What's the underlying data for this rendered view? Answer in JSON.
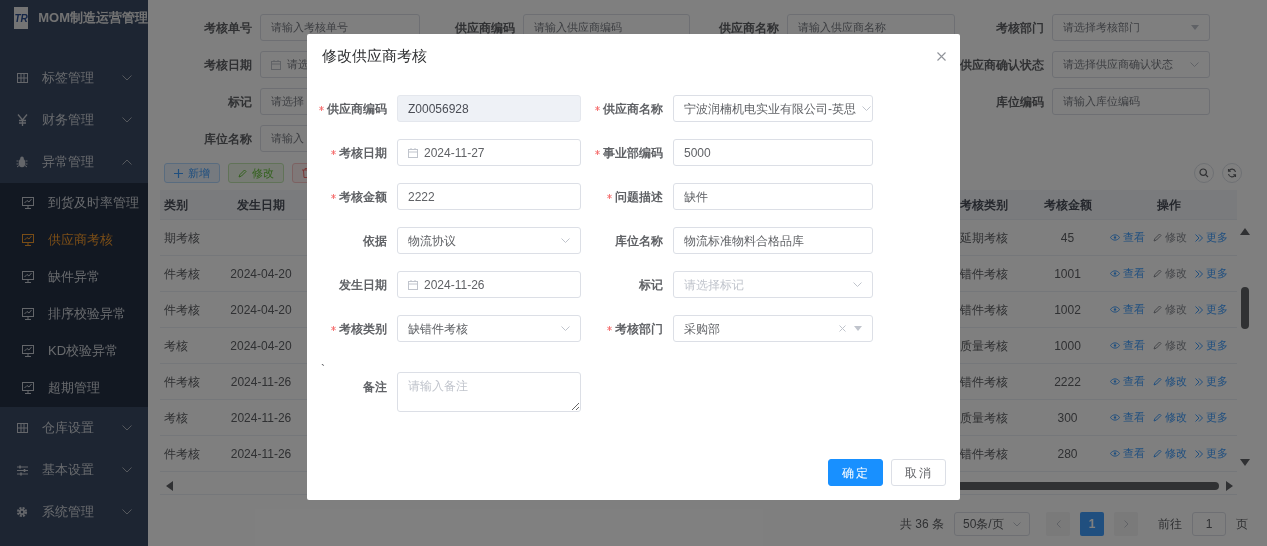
{
  "sidebar": {
    "logo_text": "TR",
    "title": "MOM制造运营管理",
    "items": [
      {
        "label": "标签管理",
        "expanded": false
      },
      {
        "label": "财务管理",
        "expanded": false
      },
      {
        "label": "异常管理",
        "expanded": true,
        "children": [
          {
            "label": "到货及时率管理",
            "selected": false
          },
          {
            "label": "供应商考核",
            "selected": true
          },
          {
            "label": "缺件异常",
            "selected": false
          },
          {
            "label": "排序校验异常",
            "selected": false
          },
          {
            "label": "KD校验异常",
            "selected": false
          },
          {
            "label": "超期管理",
            "selected": false
          }
        ]
      },
      {
        "label": "仓库设置",
        "expanded": false
      },
      {
        "label": "基本设置",
        "expanded": false
      },
      {
        "label": "系统管理",
        "expanded": false
      }
    ]
  },
  "filter_rows": [
    {
      "cells": [
        {
          "label": "考核单号",
          "kind": "text",
          "placeholder": "请输入考核单号"
        },
        {
          "label": "供应商编码",
          "kind": "text",
          "placeholder": "请输入供应商编码"
        },
        {
          "label": "供应商名称",
          "kind": "text",
          "placeholder": "请输入供应商名称"
        },
        {
          "label": "考核部门",
          "kind": "select",
          "placeholder": "请选择考核部门"
        }
      ]
    },
    {
      "cells": [
        {
          "label": "考核日期",
          "kind": "date",
          "placeholder": "请选"
        },
        {
          "label": "供应商确认状态",
          "kind": "chevron",
          "placeholder": "请选择供应商确认状态"
        }
      ]
    },
    {
      "cells": [
        {
          "label": "标记",
          "kind": "text",
          "placeholder": "请选择"
        },
        {
          "label": "库位编码",
          "kind": "text",
          "placeholder": "请输入库位编码"
        }
      ]
    },
    {
      "cells": [
        {
          "label": "库位名称",
          "kind": "text",
          "placeholder": "请输入"
        }
      ]
    }
  ],
  "toolbar": [
    {
      "kind": "add",
      "label": "新增"
    },
    {
      "kind": "edit",
      "label": "修改"
    },
    {
      "kind": "delete"
    }
  ],
  "table": {
    "left_columns": [
      "类别",
      "发生日期"
    ],
    "right_columns": [
      "考核类别",
      "考核金额",
      "操作"
    ],
    "rows": [
      {
        "category_cut": "期考核",
        "category": "延期考核",
        "amount": "45",
        "actions": [
          {
            "kind": "view",
            "label": "查看",
            "disabled": false
          },
          {
            "kind": "edit",
            "label": "修改",
            "disabled": true
          },
          {
            "kind": "more",
            "label": "更多",
            "disabled": false
          }
        ]
      },
      {
        "category_cut": "件考核",
        "date": "2024-04-20",
        "category": "错件考核",
        "amount": "1001",
        "actions": [
          {
            "kind": "view",
            "label": "查看",
            "disabled": false
          },
          {
            "kind": "edit",
            "label": "修改",
            "disabled": true
          },
          {
            "kind": "more",
            "label": "更多",
            "disabled": false
          }
        ]
      },
      {
        "category_cut": "件考核",
        "date": "2024-04-20",
        "category": "错件考核",
        "amount": "1002",
        "actions": [
          {
            "kind": "view",
            "label": "查看",
            "disabled": false
          },
          {
            "kind": "edit",
            "label": "修改",
            "disabled": true
          },
          {
            "kind": "more",
            "label": "更多",
            "disabled": false
          }
        ]
      },
      {
        "category_cut": "考核",
        "date": "2024-04-20",
        "category": "质量考核",
        "amount": "1000",
        "actions": [
          {
            "kind": "view",
            "label": "查看",
            "disabled": false
          },
          {
            "kind": "edit",
            "label": "修改",
            "disabled": true
          },
          {
            "kind": "more",
            "label": "更多",
            "disabled": false
          }
        ]
      },
      {
        "category_cut": "件考核",
        "date": "2024-11-26",
        "category": "错件考核",
        "amount": "2222",
        "actions": [
          {
            "kind": "view",
            "label": "查看",
            "disabled": false
          },
          {
            "kind": "edit",
            "label": "修改",
            "disabled": false
          },
          {
            "kind": "more",
            "label": "更多",
            "disabled": false
          }
        ]
      },
      {
        "category_cut": "考核",
        "date": "2024-11-26",
        "category": "质量考核",
        "amount": "300",
        "actions": [
          {
            "kind": "view",
            "label": "查看",
            "disabled": false
          },
          {
            "kind": "edit",
            "label": "修改",
            "disabled": false
          },
          {
            "kind": "more",
            "label": "更多",
            "disabled": false
          }
        ]
      },
      {
        "category_cut": "件考核",
        "date": "2024-11-26",
        "category": "错件考核",
        "amount": "280",
        "actions": [
          {
            "kind": "view",
            "label": "查看",
            "disabled": false
          },
          {
            "kind": "edit",
            "label": "修改",
            "disabled": false
          },
          {
            "kind": "more",
            "label": "更多",
            "disabled": false
          }
        ]
      }
    ]
  },
  "pagination": {
    "total": "共 36 条",
    "page_size": "50条/页",
    "pages": [
      {
        "label": "1",
        "selected": true
      }
    ],
    "goto_label": "前往",
    "goto_value": "1",
    "page_unit": "页"
  },
  "dialog": {
    "title": "修改供应商考核",
    "fields": [
      {
        "label": "供应商编码",
        "required": true,
        "kind": "text",
        "value": "Z00056928",
        "disabled": true
      },
      {
        "label": "供应商名称",
        "required": true,
        "kind": "select",
        "value": "宁波润楠机电实业有限公司-英思",
        "disabled": false
      },
      {
        "label": "考核日期",
        "required": true,
        "kind": "date",
        "value": "2024-11-27",
        "disabled": false
      },
      {
        "label": "事业部编码",
        "required": true,
        "kind": "text",
        "value": "5000",
        "disabled": false
      },
      {
        "label": "考核金额",
        "required": true,
        "kind": "text",
        "value": "2222",
        "disabled": false
      },
      {
        "label": "问题描述",
        "required": true,
        "kind": "text",
        "value": "缺件",
        "disabled": false
      },
      {
        "label": "依据",
        "required": false,
        "kind": "select",
        "value": "物流协议",
        "disabled": false
      },
      {
        "label": "库位名称",
        "required": false,
        "kind": "text",
        "value": "物流标准物料合格品库",
        "disabled": false
      },
      {
        "label": "发生日期",
        "required": false,
        "kind": "date",
        "value": "2024-11-26",
        "disabled": false
      },
      {
        "label": "标记",
        "required": false,
        "kind": "select",
        "placeholder": "请选择标记",
        "disabled": false
      },
      {
        "label": "考核类别",
        "required": true,
        "kind": "select",
        "value": "缺错件考核",
        "disabled": false
      },
      {
        "label": "考核部门",
        "required": true,
        "kind": "clearable",
        "value": "采购部",
        "disabled": false
      }
    ],
    "stray_mark": "`",
    "remark": {
      "label": "备注",
      "placeholder": "请输入备注"
    },
    "buttons": [
      {
        "kind": "primary",
        "label": "确定"
      },
      {
        "kind": "default",
        "label": "取消"
      }
    ]
  }
}
